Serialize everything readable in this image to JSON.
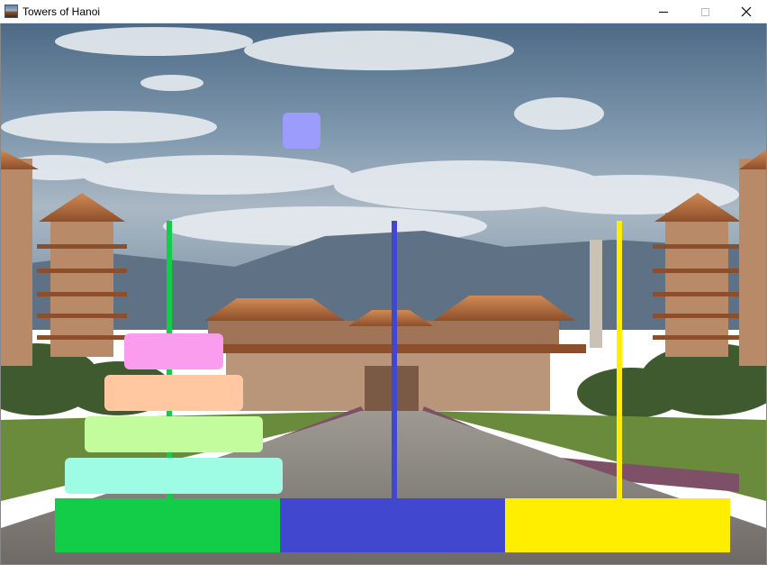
{
  "window": {
    "title": "Towers of Hanoi",
    "icon": "app-icon-temple",
    "controls": [
      "minimize-icon",
      "maximize-icon",
      "close-icon"
    ]
  },
  "game": {
    "pegs": [
      {
        "name": "left",
        "color": "#13cc47",
        "base_color": "#13cc47"
      },
      {
        "name": "middle",
        "color": "#4247cf",
        "base_color": "#4247cf"
      },
      {
        "name": "right",
        "color": "#ffee00",
        "base_color": "#ffee00"
      }
    ],
    "disks_on_left_peg_bottom_to_top": [
      {
        "color": "#9dfce3",
        "size_rank": 4
      },
      {
        "color": "#c3fc9c",
        "size_rank": 3
      },
      {
        "color": "#ffc8a0",
        "size_rank": 2
      },
      {
        "color": "#fb9dee",
        "size_rank": 1
      }
    ],
    "held_disk": {
      "color": "#9c9cfc",
      "size_rank": 0
    },
    "background": "temple-courtyard-photo"
  }
}
